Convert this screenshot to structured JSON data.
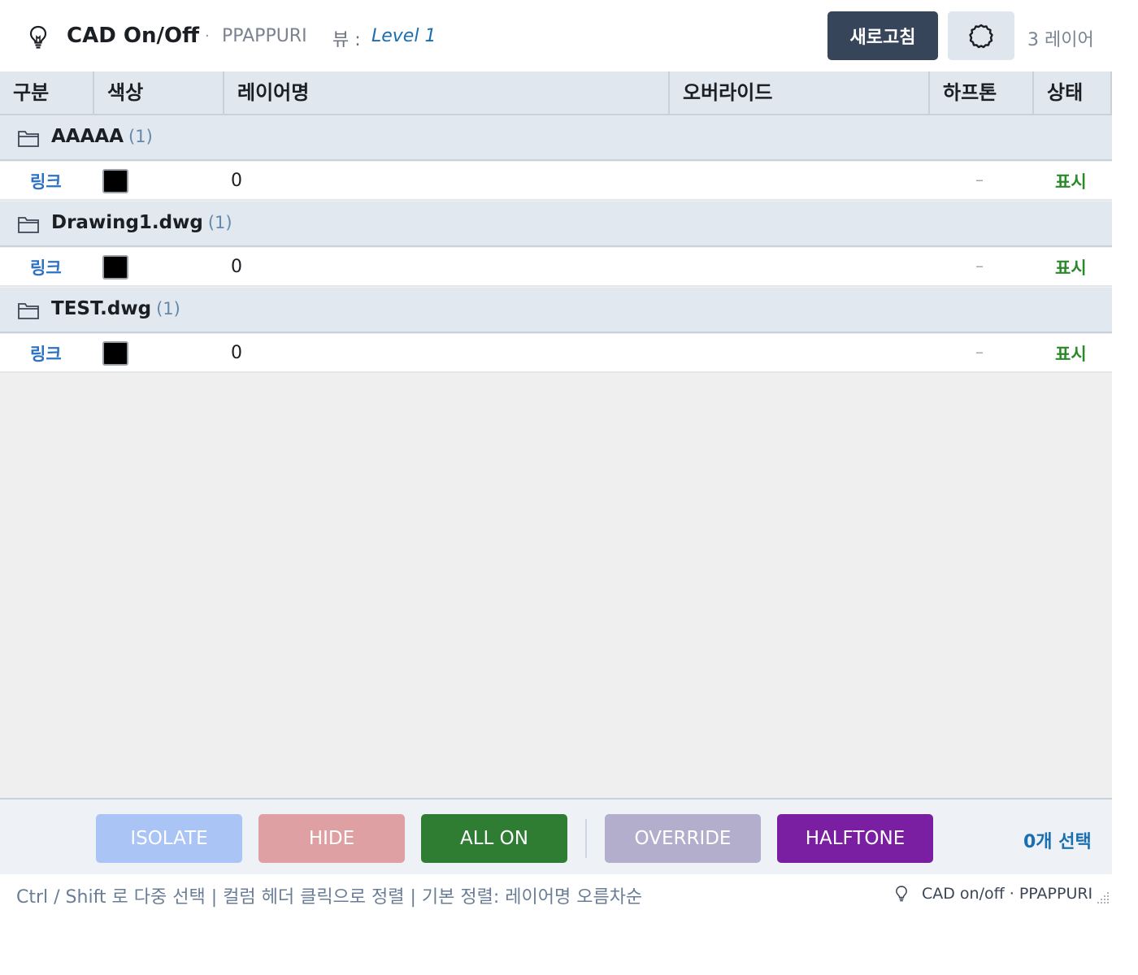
{
  "header": {
    "title": "CAD On/Off",
    "separator": "·",
    "project": "PPAPPURI",
    "view_label": "뷰 :",
    "view_value": "Level 1",
    "refresh_label": "새로고침",
    "layer_count": "3 레이어"
  },
  "columns": [
    "구분",
    "색상",
    "레이어명",
    "오버라이드",
    "하프톤",
    "상태"
  ],
  "groups": [
    {
      "name": "AAAAA",
      "count": "(1)",
      "rows": [
        {
          "type": "링크",
          "color": "#000000",
          "layer": "0",
          "override": "",
          "halftone": "–",
          "state": "표시"
        }
      ]
    },
    {
      "name": "Drawing1.dwg",
      "count": "(1)",
      "rows": [
        {
          "type": "링크",
          "color": "#000000",
          "layer": "0",
          "override": "",
          "halftone": "–",
          "state": "표시"
        }
      ]
    },
    {
      "name": "TEST.dwg",
      "count": "(1)",
      "rows": [
        {
          "type": "링크",
          "color": "#000000",
          "layer": "0",
          "override": "",
          "halftone": "–",
          "state": "표시"
        }
      ]
    }
  ],
  "toolbar": {
    "isolate": "ISOLATE",
    "hide": "HIDE",
    "all_on": "ALL ON",
    "override": "OVERRIDE",
    "halftone": "HALFTONE",
    "selected": "0개 선택"
  },
  "footer": {
    "hint": "Ctrl / Shift 로 다중 선택  |  컬럼 헤더 클릭으로 정렬  |  기본 정렬: 레이어명 오름차순",
    "brand": "CAD on/off  ·  PPAPPURI"
  },
  "colors": {
    "refresh": "#364559",
    "isolate": "#a9c4f5",
    "hide": "#dfa0a3",
    "all_on": "#2e7d32",
    "override": "#b3aecb",
    "halftone": "#7b1fa2",
    "link": "#2d72c2",
    "state_on": "#2a8a2a"
  }
}
